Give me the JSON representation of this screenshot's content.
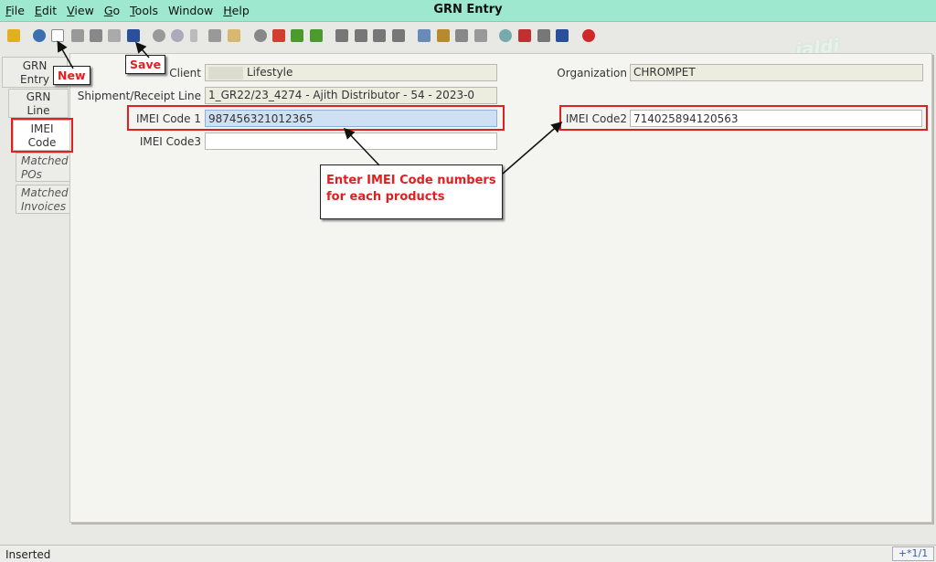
{
  "window": {
    "title": "GRN Entry"
  },
  "menu": [
    {
      "key": "F",
      "rest": "ile"
    },
    {
      "key": "E",
      "rest": "dit"
    },
    {
      "key": "V",
      "rest": "iew"
    },
    {
      "key": "G",
      "rest": "o"
    },
    {
      "key": "T",
      "rest": "ools"
    },
    {
      "key": "",
      "rest": "Window"
    },
    {
      "key": "H",
      "rest": "elp"
    }
  ],
  "toolbar_icons": [
    "undo-icon",
    "help-icon",
    "new-record-icon",
    "copy-icon",
    "delete-icon",
    "delete-selection-icon",
    "save-icon",
    "refresh-icon",
    "find-icon",
    "attachment-icon",
    "chat-icon",
    "history-icon",
    "home-icon",
    "menu-icon",
    "previous-icon",
    "next-icon",
    "first-record-icon",
    "previous-record-icon",
    "next-record-icon",
    "last-record-icon",
    "report-icon",
    "archive-icon",
    "print-icon",
    "print-preview-icon",
    "zoom-across-icon",
    "process-icon",
    "workflow-icon",
    "product-icon",
    "close-icon"
  ],
  "tabs": [
    {
      "label_1": "GRN",
      "label_2": "Entry"
    },
    {
      "label_1": "GRN",
      "label_2": "Line"
    },
    {
      "label_1": "IMEI",
      "label_2": "Code"
    },
    {
      "label_1": "Matched",
      "label_2": "POs"
    },
    {
      "label_1": "Matched",
      "label_2": "Invoices"
    }
  ],
  "form": {
    "client_label": "Client",
    "client_value": "Lifestyle",
    "organization_label": "Organization",
    "organization_value": "CHROMPET",
    "shipment_label": "Shipment/Receipt Line",
    "shipment_value": "1_GR22/23_4274 - Ajith Distributor - 54 - 2023-0",
    "imei1_label": "IMEI Code 1",
    "imei1_value": "987456321012365",
    "imei2_label": "IMEI Code2",
    "imei2_value": "714025894120563",
    "imei3_label": "IMEI Code3",
    "imei3_value": ""
  },
  "annotations": {
    "new": "New",
    "save": "Save",
    "note_line1": "Enter IMEI Code numbers",
    "note_line2": "for each products"
  },
  "watermark": "jaldi",
  "status": {
    "text": "Inserted",
    "record": "+*1/1"
  }
}
